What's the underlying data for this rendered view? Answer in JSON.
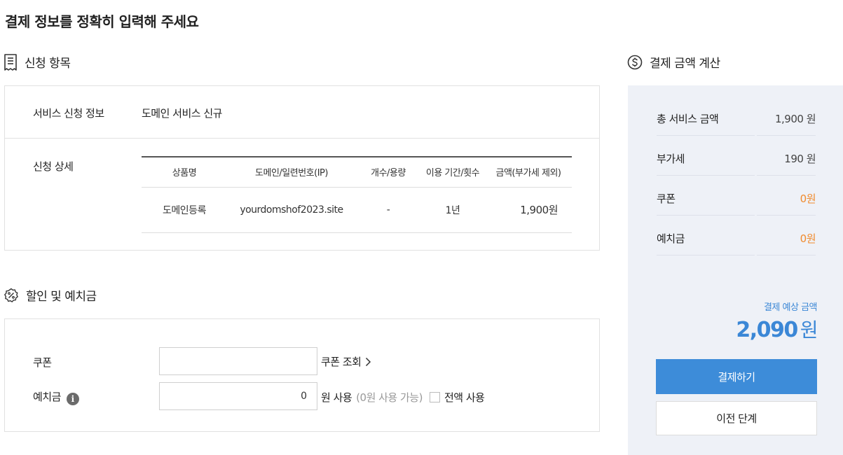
{
  "page_title": "결제 정보를 정확히 입력해 주세요",
  "apply_section": {
    "title": "신청 항목",
    "service_label": "서비스 신청 정보",
    "service_value": "도메인 서비스 신규",
    "detail_label": "신청 상세",
    "table": {
      "headers": [
        "상품명",
        "도메인/일련번호(IP)",
        "개수/용량",
        "이용 기간/횟수",
        "금액(부가세 제외)"
      ],
      "rows": [
        [
          "도메인등록",
          "yourdomshof2023.site",
          "-",
          "1년",
          "1,900원"
        ]
      ]
    }
  },
  "discount_section": {
    "title": "할인 및 예치금",
    "coupon_label": "쿠폰",
    "coupon_input_value": "",
    "coupon_lookup_label": "쿠폰 조회",
    "deposit_label": "예치금",
    "deposit_input_value": "0",
    "deposit_use_label": "원 사용",
    "deposit_available": "(0원 사용 가능)",
    "use_all_label": "전액 사용"
  },
  "calc_section": {
    "title": "결제 금액 계산",
    "rows": [
      {
        "label": "총 서비스 금액",
        "value": "1,900 원"
      },
      {
        "label": "부가세",
        "value": "190 원"
      },
      {
        "label": "쿠폰",
        "value": "0원"
      },
      {
        "label": "예치금",
        "value": "0원"
      }
    ],
    "expected_label": "결제 예상 금액",
    "expected_value": "2,090",
    "expected_unit": "원",
    "pay_button": "결제하기",
    "prev_button": "이전 단계"
  },
  "colors": {
    "accent_blue": "#3d8cd9",
    "amount_blue": "#3b87d6",
    "orange": "#f08a2c",
    "panel_bg": "#eef1f7"
  }
}
